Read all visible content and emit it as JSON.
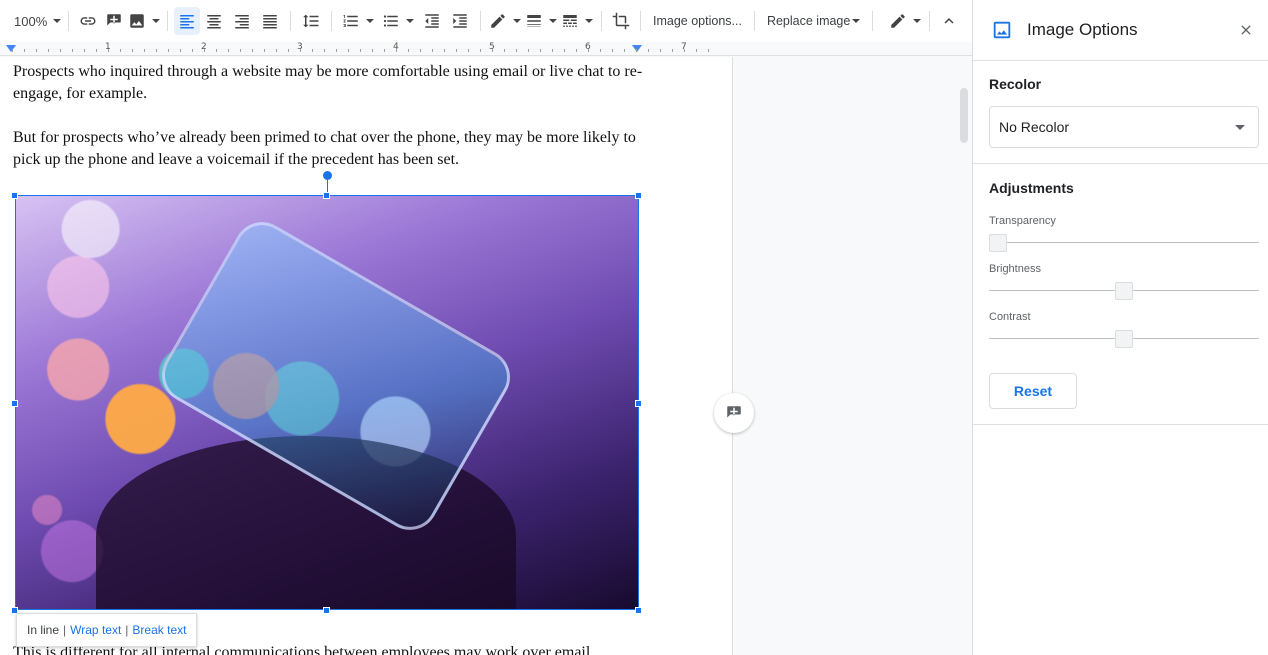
{
  "toolbar": {
    "zoom": "100%",
    "image_options": "Image options...",
    "replace_image": "Replace image"
  },
  "ruler": {
    "numbers": [
      "1",
      "2",
      "3",
      "4",
      "5",
      "6",
      "7"
    ]
  },
  "document": {
    "para1": "Prospects who inquired through a website may be more comfortable using email or live chat to re-engage, for example.",
    "para2": "But for prospects who’ve already been primed to chat over the phone, they may be more likely to pick up the phone and leave a voicemail if the precedent has been set.",
    "para3": "This is different for all internal communications between employees may work over email",
    "wrap_options": {
      "inline": "In line",
      "wrap": "Wrap text",
      "break": "Break text"
    }
  },
  "panel": {
    "title": "Image Options",
    "recolor_title": "Recolor",
    "recolor_value": "No Recolor",
    "adjustments_title": "Adjustments",
    "sliders": [
      {
        "label": "Transparency",
        "value": 0
      },
      {
        "label": "Brightness",
        "value": 0.5
      },
      {
        "label": "Contrast",
        "value": 0.5
      }
    ],
    "reset_label": "Reset"
  },
  "colors": {
    "accent": "#1a73e8",
    "toolbar_active_bg": "#e8f0fe"
  }
}
